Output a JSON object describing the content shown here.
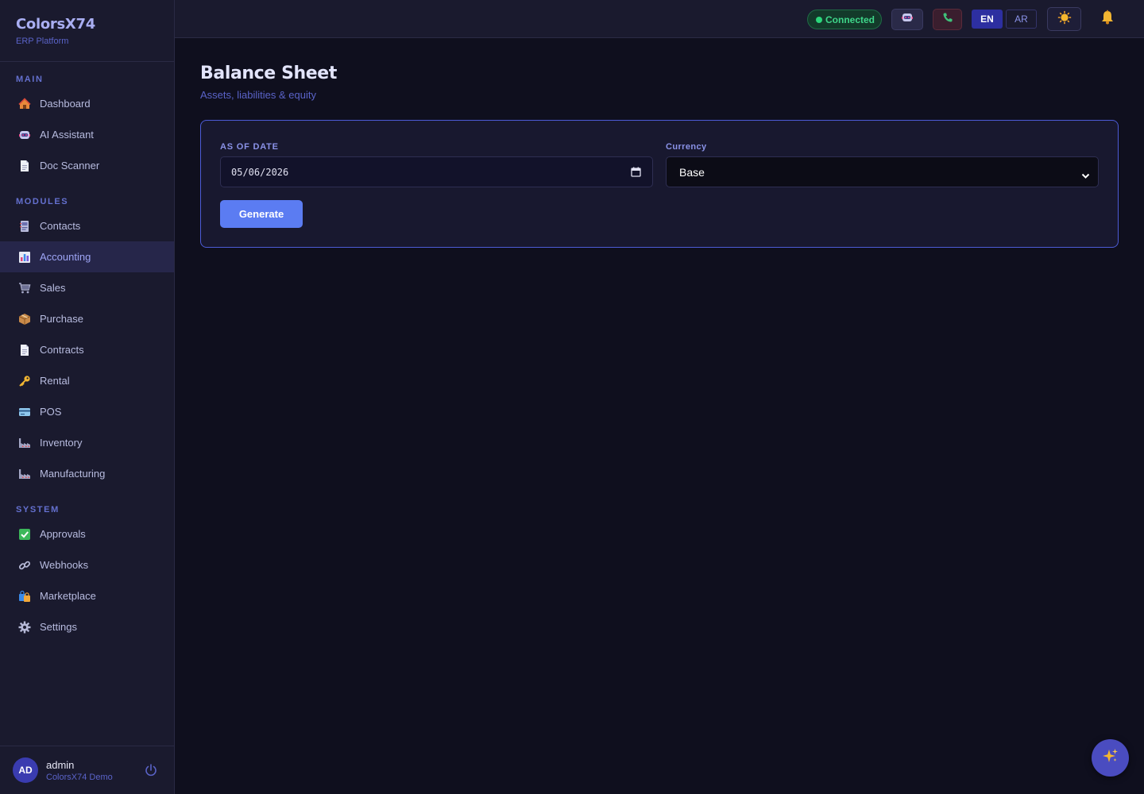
{
  "brand": {
    "name": "ColorsX74",
    "subtitle": "ERP Platform"
  },
  "sidebar": {
    "sections": [
      {
        "label": "MAIN",
        "items": [
          {
            "label": "Dashboard",
            "icon": "house-icon"
          },
          {
            "label": "AI Assistant",
            "icon": "robot-icon"
          },
          {
            "label": "Doc Scanner",
            "icon": "document-icon"
          }
        ]
      },
      {
        "label": "MODULES",
        "items": [
          {
            "label": "Contacts",
            "icon": "contacts-icon"
          },
          {
            "label": "Accounting",
            "icon": "bar-chart-icon",
            "active": true
          },
          {
            "label": "Sales",
            "icon": "cart-icon"
          },
          {
            "label": "Purchase",
            "icon": "package-icon"
          },
          {
            "label": "Contracts",
            "icon": "document-icon"
          },
          {
            "label": "Rental",
            "icon": "key-icon"
          },
          {
            "label": "POS",
            "icon": "credit-card-icon"
          },
          {
            "label": "Inventory",
            "icon": "factory-icon"
          },
          {
            "label": "Manufacturing",
            "icon": "factory-icon"
          }
        ]
      },
      {
        "label": "SYSTEM",
        "items": [
          {
            "label": "Approvals",
            "icon": "checkmark-icon"
          },
          {
            "label": "Webhooks",
            "icon": "link-icon"
          },
          {
            "label": "Marketplace",
            "icon": "shopping-bags-icon"
          },
          {
            "label": "Settings",
            "icon": "gear-icon"
          }
        ]
      }
    ]
  },
  "user": {
    "initials": "AD",
    "name": "admin",
    "org": "ColorsX74 Demo"
  },
  "topbar": {
    "status": "Connected",
    "languages": [
      "EN",
      "AR"
    ],
    "active_language": "EN"
  },
  "page": {
    "title": "Balance Sheet",
    "subtitle": "Assets, liabilities & equity"
  },
  "form": {
    "date_label": "AS OF DATE",
    "date_value": "05/06/2026",
    "currency_label": "Currency",
    "currency_value": "Base",
    "generate_label": "Generate"
  },
  "colors": {
    "accent": "#5b7cf2",
    "background": "#0f0f1e",
    "sidebar": "#1a1a2e",
    "status_green": "#3fd68a"
  }
}
